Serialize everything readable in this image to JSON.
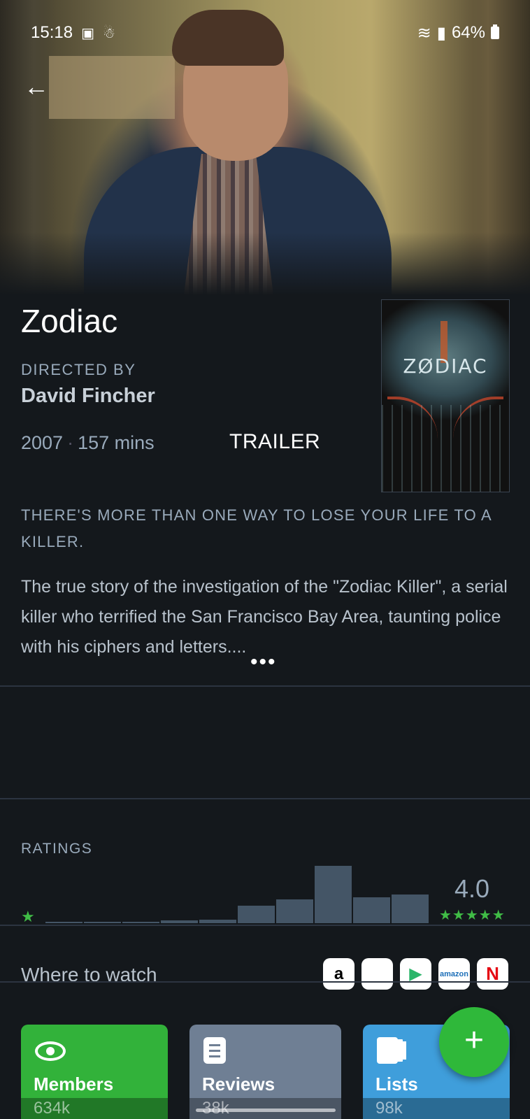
{
  "status_bar": {
    "time": "15:18",
    "battery": "64%"
  },
  "film": {
    "title": "Zodiac",
    "directed_by_label": "DIRECTED BY",
    "director": "David Fincher",
    "year": "2007",
    "runtime": "157 mins",
    "trailer_label": "TRAILER",
    "poster_title": "ZØDIAC",
    "tagline": "THERE'S MORE THAN ONE WAY TO LOSE YOUR LIFE TO A KILLER.",
    "synopsis": "The true story of the investigation of the \"Zodiac Killer\", a serial killer who terrified the San Francisco Bay Area, taunting police with his ciphers and letters....",
    "more_label": "•••"
  },
  "ratings": {
    "label": "RATINGS",
    "average": "4.0",
    "min_star": "★",
    "max_stars": "★★★★★",
    "histogram": [
      0.01,
      0.01,
      0.01,
      0.05,
      0.06,
      0.31,
      0.42,
      1.0,
      0.45,
      0.5
    ],
    "accent_color": "#40bc46"
  },
  "where_to_watch": {
    "label": "Where to watch",
    "services": [
      {
        "name": "amazon",
        "glyph": "a"
      },
      {
        "name": "apple",
        "glyph": ""
      },
      {
        "name": "google-play",
        "glyph": "▶"
      },
      {
        "name": "amazon-fresh",
        "glyph": "amazon"
      },
      {
        "name": "netflix",
        "glyph": "N"
      }
    ]
  },
  "tiles": {
    "members": {
      "label": "Members",
      "count": "634k",
      "color": "#32b23a"
    },
    "reviews": {
      "label": "Reviews",
      "count": "38k",
      "color": "#6f7f94"
    },
    "lists": {
      "label": "Lists",
      "count": "98k",
      "color": "#3f9edb"
    }
  },
  "fab": {
    "label": "+"
  }
}
